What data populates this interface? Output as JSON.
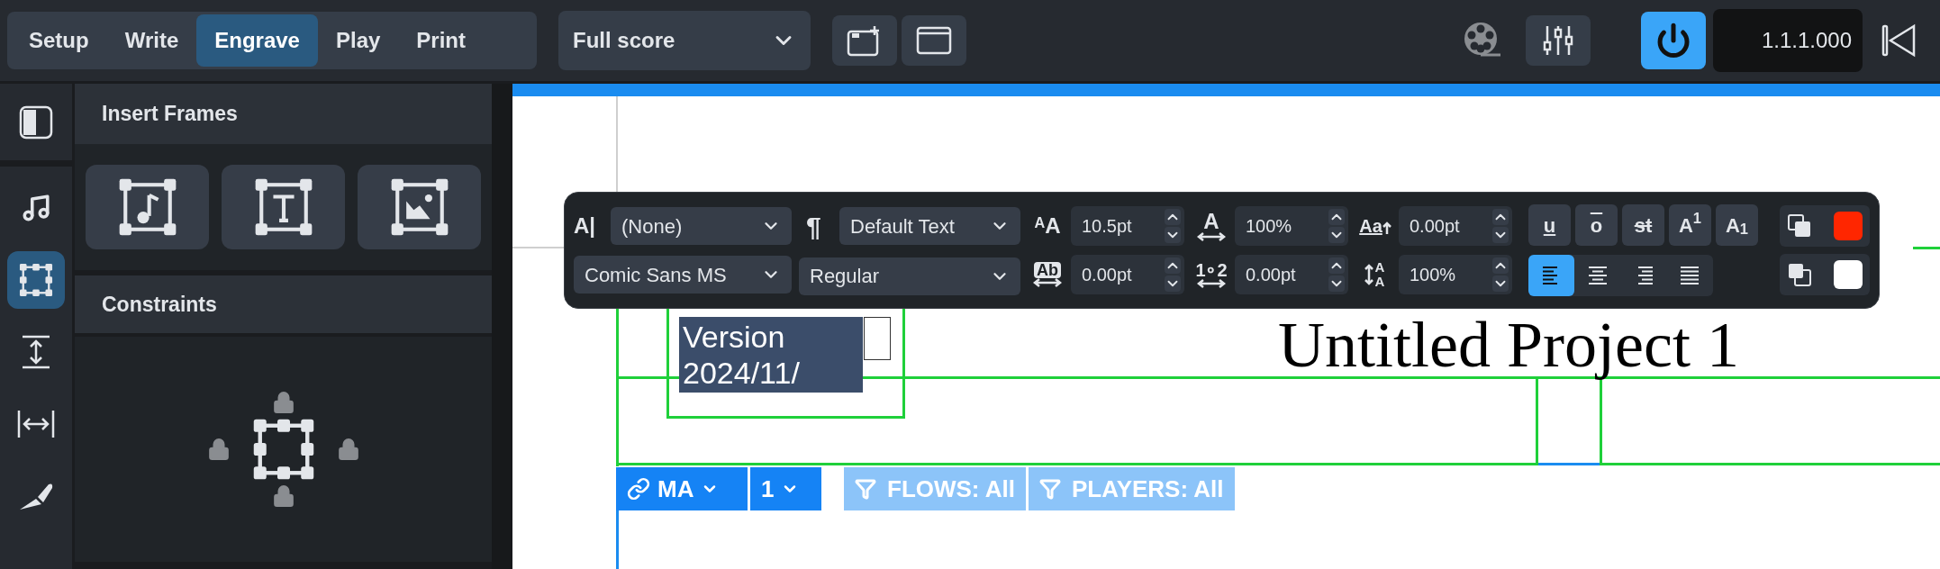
{
  "mode_tabs": [
    {
      "label": "Setup",
      "selected": false
    },
    {
      "label": "Write",
      "selected": false
    },
    {
      "label": "Engrave",
      "selected": true
    },
    {
      "label": "Play",
      "selected": false
    },
    {
      "label": "Print",
      "selected": false
    }
  ],
  "layout_selector": {
    "value": "Full score"
  },
  "click_toggle": {
    "on": true
  },
  "position_display": {
    "value": "1.1.1.000"
  },
  "tool_sidebar": {
    "items": [
      {
        "kind": "note",
        "selected": false
      },
      {
        "kind": "frame",
        "selected": true
      },
      {
        "kind": "spacing",
        "selected": false
      },
      {
        "kind": "width",
        "selected": false
      },
      {
        "kind": "graphic",
        "selected": false
      }
    ]
  },
  "panels": [
    {
      "title": "Insert Frames",
      "frame_buttons": [
        {
          "kind": "music"
        },
        {
          "kind": "text"
        },
        {
          "kind": "graphic"
        }
      ]
    },
    {
      "title": "Constraints"
    }
  ],
  "text_toolbar": {
    "character_style": {
      "symbol": "A|",
      "value": "(None)"
    },
    "paragraph_style": {
      "symbol": "¶",
      "value": "Default Text"
    },
    "font_family": {
      "value": "Comic Sans MS"
    },
    "font_style": {
      "value": "Regular"
    },
    "spin_fields": [
      {
        "kind": "size",
        "symbol": "ᴬA",
        "value": "10.5pt"
      },
      {
        "kind": "scale",
        "symbol": "A",
        "value": "100%"
      },
      {
        "kind": "shift",
        "symbol": "Aa",
        "value": "0.00pt"
      },
      {
        "kind": "boxed",
        "symbol": "Ab",
        "value": "0.00pt"
      },
      {
        "kind": "spacing",
        "symbol": "1∘2",
        "value": "0.00pt"
      },
      {
        "kind": "stacked",
        "symbol": "AA",
        "value": "100%"
      }
    ],
    "style_buttons": [
      {
        "kind": "underline",
        "label": "u",
        "selected": false
      },
      {
        "kind": "overline",
        "label": "o",
        "selected": false
      },
      {
        "kind": "strike",
        "label": "st",
        "selected": false
      },
      {
        "kind": "plain",
        "label": "A$^{1}$",
        "selected": false
      },
      {
        "kind": "plain",
        "label": "A$_{1}$",
        "selected": false
      }
    ],
    "align_buttons": [
      {
        "kind": "left",
        "selected": true
      },
      {
        "kind": "center",
        "selected": false
      },
      {
        "kind": "right",
        "selected": false
      },
      {
        "kind": "justify",
        "selected": false
      }
    ],
    "colors": [
      {
        "kind": "foreground",
        "color": "#ff2600"
      },
      {
        "kind": "background",
        "color": "#ffffff"
      }
    ]
  },
  "score": {
    "title": "Untitled Project 1",
    "text_frame": {
      "lines": [
        "Version",
        "2024/11/"
      ]
    }
  },
  "layout_chips": [
    {
      "kind": "link",
      "label": "MA"
    },
    {
      "kind": "number",
      "label": "1"
    }
  ],
  "filters": [
    {
      "label": "FLOWS: All"
    },
    {
      "label": "PLAYERS: All"
    }
  ]
}
